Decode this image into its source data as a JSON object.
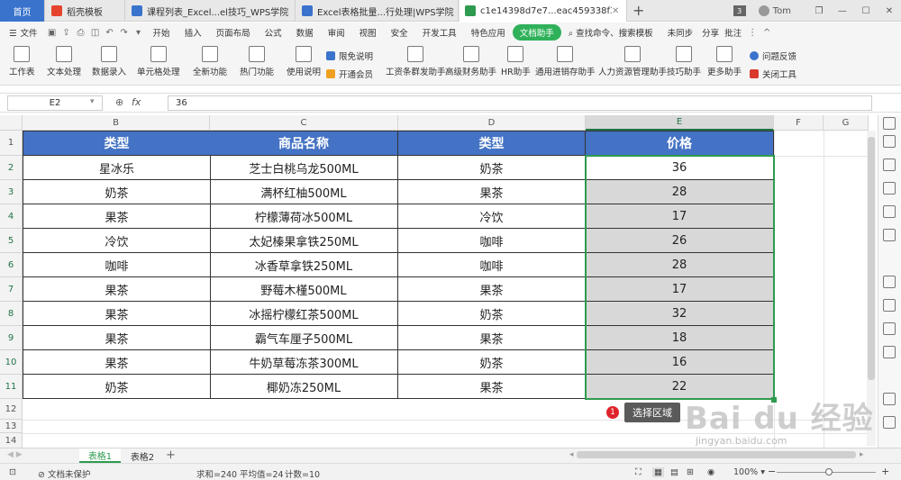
{
  "tabs": {
    "home": "首页",
    "items": [
      {
        "label": "稻壳模板",
        "color": "#e5432e"
      },
      {
        "label": "课程列表_Excel...el技巧_WPS学院",
        "color": "#3a73cc"
      },
      {
        "label": "Excel表格批量...行处理|WPS学院",
        "color": "#3a73cc"
      },
      {
        "label": "c1e14398d7e7...eac459338f36",
        "color": "#2e9a4f"
      }
    ],
    "new_tab": "+",
    "user": "Tom",
    "badge": "3"
  },
  "menu": {
    "file": "文件",
    "items": [
      "开始",
      "插入",
      "页面布局",
      "公式",
      "数据",
      "审阅",
      "视图",
      "安全",
      "开发工具",
      "特色应用"
    ],
    "active": "文档助手",
    "search": "查找命令、搜索模板",
    "sync": "未同步",
    "share": "分享",
    "comment": "批注"
  },
  "ribbon": {
    "buttons": [
      "工作表",
      "文本处理",
      "数据录入",
      "单元格处理",
      "全新功能",
      "热门功能",
      "使用说明"
    ],
    "limited": "限免说明",
    "member": "开通会员",
    "tools": [
      "工资条群发助手",
      "高级财务助手",
      "HR助手",
      "通用进销存助手",
      "人力资源管理助手",
      "技巧助手",
      "更多助手"
    ],
    "feedback": "问题反馈",
    "close": "关闭工具"
  },
  "formula_bar": {
    "cell_ref": "E2",
    "fx": "fx",
    "value": "36"
  },
  "sheet": {
    "columns": [
      "B",
      "C",
      "D",
      "E",
      "F",
      "G"
    ],
    "rows": [
      "1",
      "2",
      "3",
      "4",
      "5",
      "6",
      "7",
      "8",
      "9",
      "10",
      "11",
      "12",
      "13",
      "14"
    ],
    "headers": [
      "类型",
      "商品名称",
      "类型",
      "价格"
    ],
    "data": [
      [
        "星冰乐",
        "芝士白桃乌龙500ML",
        "奶茶",
        "36"
      ],
      [
        "奶茶",
        "满杯红柚500ML",
        "果茶",
        "28"
      ],
      [
        "果茶",
        "柠檬薄荷冰500ML",
        "冷饮",
        "17"
      ],
      [
        "冷饮",
        "太妃榛果拿铁250ML",
        "咖啡",
        "26"
      ],
      [
        "咖啡",
        "冰香草拿铁250ML",
        "咖啡",
        "28"
      ],
      [
        "果茶",
        "野莓木槿500ML",
        "果茶",
        "17"
      ],
      [
        "果茶",
        "冰摇柠檬红茶500ML",
        "奶茶",
        "32"
      ],
      [
        "果茶",
        "霸气车厘子500ML",
        "果茶",
        "18"
      ],
      [
        "果茶",
        "牛奶草莓冻茶300ML",
        "奶茶",
        "16"
      ],
      [
        "奶茶",
        "椰奶冻250ML",
        "果茶",
        "22"
      ]
    ],
    "annotation_badge": "1",
    "annotation_text": "选择区域"
  },
  "sheet_tabs": [
    "表格1",
    "表格2"
  ],
  "status": {
    "protect": "文档未保护",
    "sum": "求和=240",
    "avg": "平均值=24",
    "count": "计数=10",
    "zoom": "100%"
  },
  "watermark": {
    "text": "Bai du 经验",
    "url": "jingyan.baidu.com"
  },
  "colors": {
    "header_blue": "#4472c4",
    "select_green": "#2e9a4f",
    "price_gray": "#d8d8d8"
  }
}
